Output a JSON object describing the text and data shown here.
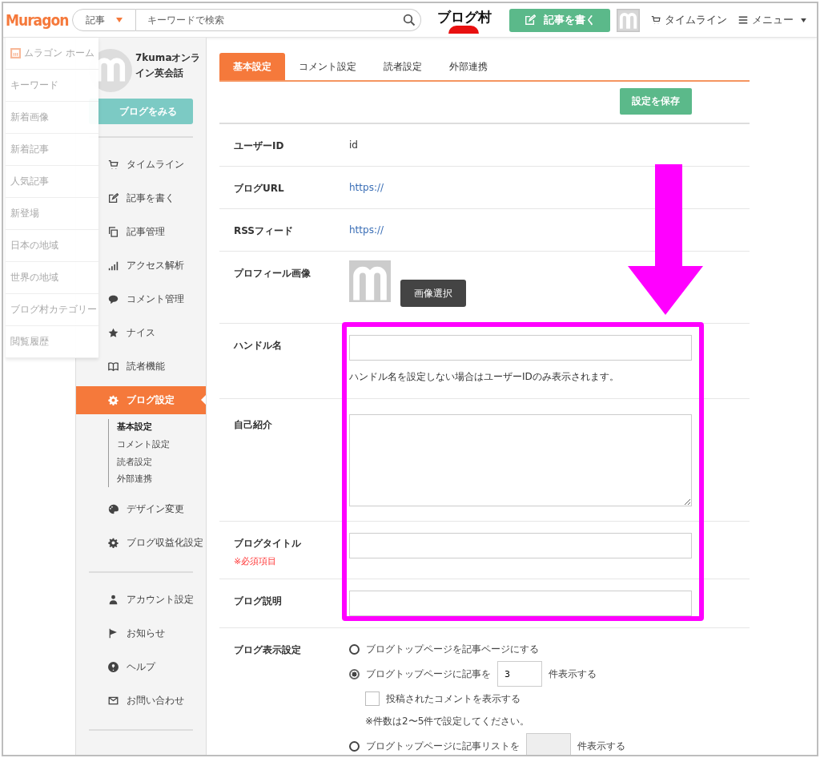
{
  "header": {
    "logo": "Muragon",
    "search": {
      "category": "記事",
      "placeholder": "キーワードで検索"
    },
    "partner_logo": "ブログ村",
    "write_button": "記事を書く",
    "timeline": "タイムライン",
    "menu": "メニュー"
  },
  "dropdown_menu": {
    "items": [
      "ムラゴン ホーム",
      "キーワード",
      "新着画像",
      "新着記事",
      "人気記事",
      "新登場",
      "日本の地域",
      "世界の地域",
      "ブログ村カテゴリー",
      "閲覧履歴"
    ]
  },
  "sidebar": {
    "blog_name": "7kumaオンライン英会話",
    "view_button": "ブログをみる",
    "groups": [
      [
        {
          "label": "タイムライン",
          "selected": false
        },
        {
          "label": "記事を書く",
          "selected": false
        },
        {
          "label": "記事管理",
          "selected": false
        },
        {
          "label": "アクセス解析",
          "selected": false
        },
        {
          "label": "コメント管理",
          "selected": false
        },
        {
          "label": "ナイス",
          "selected": false
        },
        {
          "label": "読者機能",
          "selected": false
        },
        {
          "label": "ブログ設定",
          "selected": true,
          "children": [
            {
              "label": "基本設定",
              "selected": true
            },
            {
              "label": "コメント設定",
              "selected": false
            },
            {
              "label": "読者設定",
              "selected": false
            },
            {
              "label": "外部連携",
              "selected": false
            }
          ]
        },
        {
          "label": "デザイン変更",
          "selected": false
        },
        {
          "label": "ブログ収益化設定",
          "selected": false
        }
      ],
      [
        {
          "label": "アカウント設定",
          "selected": false
        },
        {
          "label": "お知らせ",
          "selected": false
        },
        {
          "label": "ヘルプ",
          "selected": false
        },
        {
          "label": "お問い合わせ",
          "selected": false
        }
      ]
    ]
  },
  "tabs": [
    {
      "label": "基本設定",
      "selected": true
    },
    {
      "label": "コメント設定",
      "selected": false
    },
    {
      "label": "読者設定",
      "selected": false
    },
    {
      "label": "外部連携",
      "selected": false
    }
  ],
  "save_button": "設定を保存",
  "fields": [
    {
      "kind": "text",
      "label": "ユーザーID",
      "value": "id"
    },
    {
      "kind": "link",
      "label": "ブログURL",
      "value": "https://"
    },
    {
      "kind": "link",
      "label": "RSSフィード",
      "value": "https://"
    },
    {
      "kind": "image",
      "label": "プロフィール画像",
      "button": "画像選択"
    },
    {
      "kind": "input",
      "label": "ハンドル名",
      "note": "ハンドル名を設定しない場合はユーザーIDのみ表示されます。"
    },
    {
      "kind": "textarea",
      "label": "自己紹介"
    },
    {
      "kind": "input",
      "label": "ブログタイトル",
      "required": "※必須項目"
    },
    {
      "kind": "input",
      "label": "ブログ説明"
    },
    {
      "kind": "options",
      "label": "ブログ表示設定",
      "options": [
        {
          "kind": "radio",
          "selected": false,
          "text": "ブログトップページを記事ページにする"
        },
        {
          "kind": "radio_count",
          "selected": true,
          "text": "ブログトップページに記事を",
          "value": "3",
          "suffix": "件表示する",
          "disabled": false
        },
        {
          "kind": "checkbox",
          "checked": false,
          "text": "投稿されたコメントを表示する"
        },
        {
          "kind": "note",
          "text": "※件数は2〜5件で設定してください。"
        },
        {
          "kind": "radio_count",
          "selected": false,
          "text": "ブログトップページに記事リストを",
          "suffix": "件表示する",
          "disabled": true
        }
      ]
    }
  ]
}
